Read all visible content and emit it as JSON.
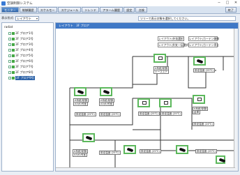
{
  "window": {
    "title": "空調制御システム",
    "controls": [
      "─",
      "□",
      "✕"
    ]
  },
  "toolbar": {
    "items": [
      "モニター",
      "制御履歴",
      "スケルモー",
      "スケジュール",
      "トレンド",
      "アラーム履歴",
      "設定",
      "点検"
    ],
    "exit": "終了"
  },
  "view": {
    "label": "表示形式:",
    "select": "レイアウト",
    "hint": "ツリーで表示対象を選択してください。"
  },
  "tree": {
    "root": "radiat",
    "items": [
      "3F プロア1号",
      "3F プロア2号",
      "3F プロア3号",
      "3F プロア4号",
      "3F プロア5号",
      "3F プロア6号",
      "3F プロア7号",
      "3F プロア8号",
      "3F プロア9号"
    ],
    "selected_index": 8
  },
  "main": {
    "header": "レイアウト　3F プロア",
    "buttons": [
      "レイアウト/外気選択",
      "レイアウト/カーテン開閉",
      "レイアウト/外気一括選択",
      "レイアウト/カーテン停止"
    ]
  },
  "labels": {
    "ac_room_a": "A系統/制御",
    "ac_room_b": "ナースステ",
    "ac_a1": "A系統/制御",
    "ac_a1b": "A5(6)号室",
    "ac_a2": "A系統/制御",
    "ac_a2b": "A5(6)号室",
    "setpoint": "設定温度 (25℃)",
    "cam1": "A系統/制御",
    "cam1b": "倉庫",
    "setpoint2": "設定温度 (24℃)"
  }
}
